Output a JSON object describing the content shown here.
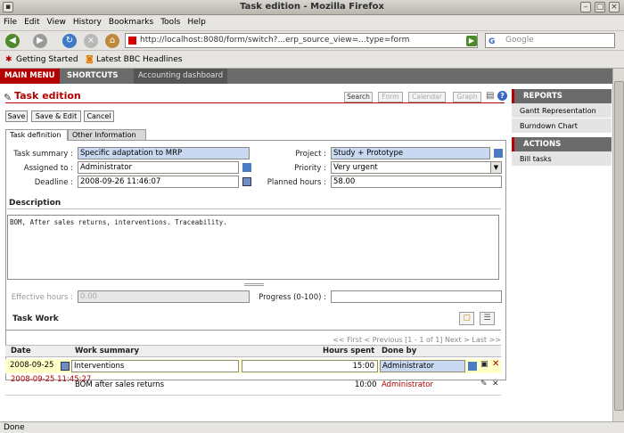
{
  "window": {
    "title": "Task edition - Mozilla Firefox"
  },
  "menu": [
    "File",
    "Edit",
    "View",
    "History",
    "Bookmarks",
    "Tools",
    "Help"
  ],
  "nav": {
    "url": "http://localhost:8080/form/switch?...erp_source_view=...type=form",
    "search_placeholder": "Google"
  },
  "bookmarks": [
    "Getting Started",
    "Latest BBC Headlines"
  ],
  "appnav": [
    "MAIN MENU",
    "SHORTCUTS",
    "Accounting dashboard"
  ],
  "page": {
    "title": "Task edition",
    "toolbar": [
      "Search",
      "Form",
      "Calendar",
      "Graph"
    ],
    "actions": [
      "Save",
      "Save & Edit",
      "Cancel"
    ]
  },
  "tabs": [
    "Task definition",
    "Other Information"
  ],
  "form": {
    "summary_label": "Task summary :",
    "summary": "Specific adaptation to MRP",
    "assigned_label": "Assigned to :",
    "assigned": "Administrator",
    "deadline_label": "Deadline :",
    "deadline": "2008-09-26 11:46:07",
    "project_label": "Project :",
    "project": "Study + Prototype",
    "priority_label": "Priority :",
    "priority": "Very urgent",
    "planned_label": "Planned hours :",
    "planned": "58.00",
    "description_label": "Description",
    "description": "BOM, After sales returns, interventions. Traceability.",
    "effective_label": "Effective hours :",
    "effective": "0.00",
    "progress_label": "Progress (0-100) :",
    "progress": ""
  },
  "taskwork": {
    "title": "Task Work",
    "pager": "<< First < Previous [1 - 1 of 1] Next > Last >>",
    "columns": [
      "Date",
      "Work summary",
      "Hours spent",
      "Done by"
    ],
    "rows": [
      {
        "date": "2008-09-25",
        "summary": "Interventions",
        "hours": "15:00",
        "done_by": "Administrator"
      },
      {
        "date": "2008-09-25 11:45:27",
        "summary": "BOM after sales returns",
        "hours": "10:00",
        "done_by": "Administrator"
      }
    ]
  },
  "sidebar": {
    "reports_title": "REPORTS",
    "reports": [
      "Gantt Representation",
      "Burndown Chart"
    ],
    "actions_title": "ACTIONS",
    "actions": [
      "Bill tasks"
    ]
  },
  "status": "Done"
}
